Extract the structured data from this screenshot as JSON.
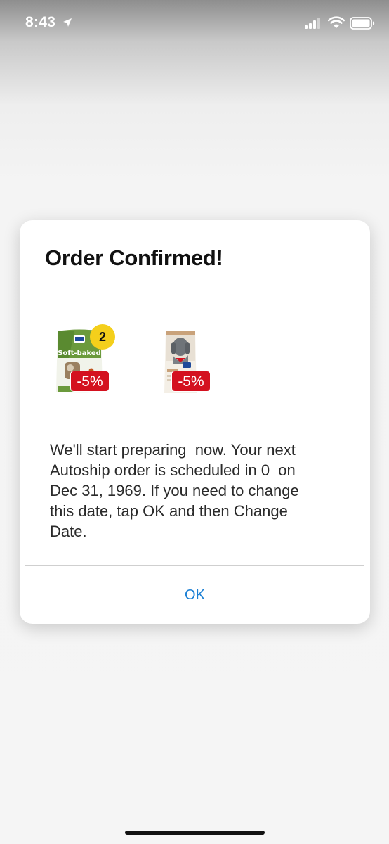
{
  "status_bar": {
    "time": "8:43",
    "location_icon": "location-arrow-icon",
    "signal_icon": "cellular-signal-icon",
    "wifi_icon": "wifi-icon",
    "battery_icon": "battery-icon"
  },
  "dialog": {
    "title": "Order Confirmed!",
    "products": [
      {
        "image": "softbaked-treats-bag",
        "brand_text": "Hill's",
        "package_text": "Soft-baked",
        "quantity": "2",
        "discount": "-5%"
      },
      {
        "image": "dog-food-bag",
        "brand_text": "Hill's",
        "discount": "-5%"
      }
    ],
    "message": "We'll start preparing  now. Your next\nAutoship order is scheduled in 0  on\nDec 31, 1969. If you need to change\nthis date, tap OK and then Change\nDate.",
    "ok_label": "OK"
  },
  "colors": {
    "accent": "#1a7fd4",
    "discount_badge": "#d4111f",
    "quantity_badge": "#f4cf1b",
    "dialog_background": "#ffffff"
  }
}
